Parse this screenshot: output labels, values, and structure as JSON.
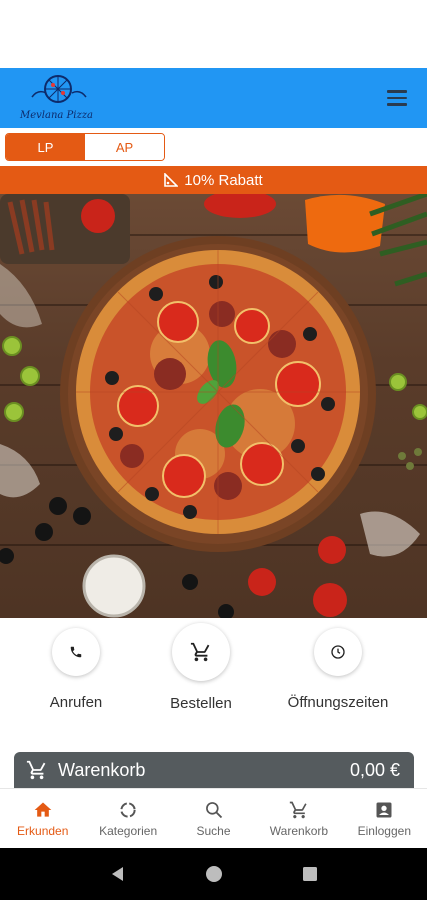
{
  "header": {
    "logo_text": "Mevlana Pizza",
    "menu_icon": "hamburger-menu-icon"
  },
  "language": {
    "options": [
      "LP",
      "AP"
    ],
    "selected": "LP"
  },
  "promo": {
    "label": "10% Rabatt",
    "icon": "discount-icon"
  },
  "hero": {
    "description_icon": "pizza-photo"
  },
  "actions": [
    {
      "label": "Anrufen",
      "icon": "phone-icon"
    },
    {
      "label": "Bestellen",
      "icon": "cart-icon"
    },
    {
      "label": "Öffnungszeiten",
      "icon": "clock-icon"
    }
  ],
  "cart": {
    "label": "Warenkorb",
    "total": "0,00 €"
  },
  "bottom_nav": {
    "active": "Erkunden",
    "items": [
      {
        "label": "Erkunden",
        "icon": "home-icon"
      },
      {
        "label": "Kategorien",
        "icon": "categories-icon"
      },
      {
        "label": "Suche",
        "icon": "search-icon"
      },
      {
        "label": "Warenkorb",
        "icon": "cart-icon"
      },
      {
        "label": "Einloggen",
        "icon": "account-icon"
      }
    ]
  },
  "colors": {
    "accent": "#e45a14",
    "header": "#2196f3",
    "cart_bar": "#555b5e"
  }
}
